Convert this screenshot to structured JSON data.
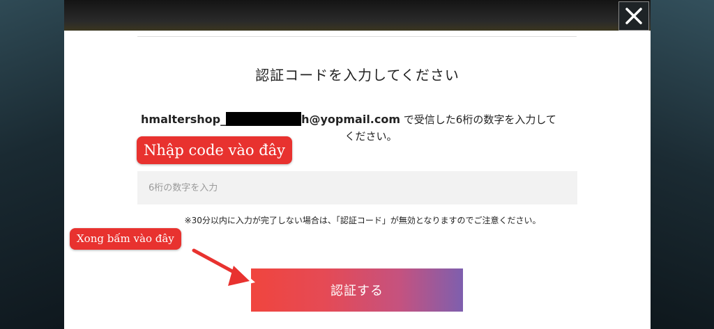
{
  "dialog": {
    "title": "認証コードを入力してください",
    "email_visible_start": "hmaltershop_",
    "email_visible_end": "h@yopmail.com",
    "instruction_1": " で受信した6桁の数字を入力して",
    "instruction_2": "ください。",
    "code_placeholder": "6桁の数字を入力",
    "code_value": "",
    "note": "※30分以内に入力が完了しない場合は、「認証コード」が無効となりますのでご注意ください。",
    "submit_label": "認証する"
  },
  "annotations": {
    "enter_code": "Nhập code vào đây",
    "then_click": "Xong bấm vào đây"
  },
  "colors": {
    "annotation": "#e8322f",
    "button_gradient_start": "#f0453e",
    "button_gradient_end": "#7e5fae"
  },
  "icons": {
    "close": "close-icon",
    "arrow": "arrow-right-icon"
  }
}
